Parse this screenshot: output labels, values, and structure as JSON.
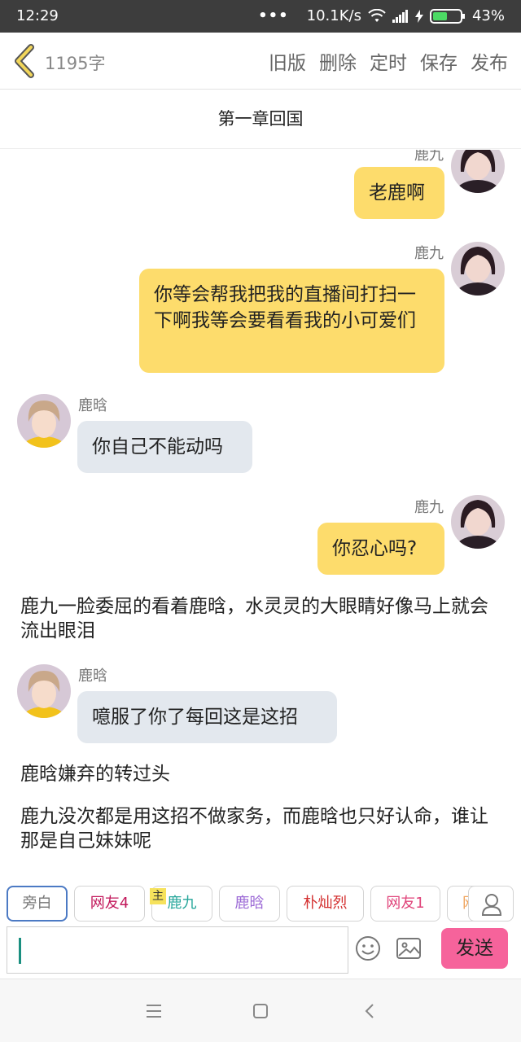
{
  "status_bar": {
    "time": "12:29",
    "dots": "•••",
    "network_speed": "10.1K/s",
    "battery": "43%"
  },
  "toolbar": {
    "back_icon": "chevron-left-icon",
    "word_count": "1195字",
    "actions": [
      "旧版",
      "删除",
      "定时",
      "保存",
      "发布"
    ]
  },
  "chapter_title": "第一章回国",
  "messages": [
    {
      "speaker": "鹿九",
      "side": "right",
      "text": "老鹿啊"
    },
    {
      "speaker": "鹿九",
      "side": "right",
      "text": "你等会帮我把我的直播间打扫一下啊我等会要看看我的小可爱们"
    },
    {
      "speaker": "鹿晗",
      "side": "left",
      "text": "你自己不能动吗"
    },
    {
      "speaker": "鹿九",
      "side": "right",
      "text": "你忍心吗?"
    },
    {
      "type": "narration",
      "text": "鹿九一脸委屈的看着鹿晗，水灵灵的大眼睛好像马上就会流出眼泪"
    },
    {
      "speaker": "鹿晗",
      "side": "left",
      "text": "噫服了你了每回这是这招"
    },
    {
      "type": "narration",
      "text": "鹿晗嫌弃的转过头"
    },
    {
      "type": "narration",
      "text": "鹿九没次都是用这招不做家务，而鹿晗也只好认命，谁让那是自己妹妹呢"
    }
  ],
  "roles": [
    {
      "label": "旁白",
      "color": "#888888",
      "active": true
    },
    {
      "label": "网友4",
      "color": "#c2185b"
    },
    {
      "label": "鹿九",
      "color": "#26a69a",
      "badge": "主"
    },
    {
      "label": "鹿晗",
      "color": "#9c6ad6"
    },
    {
      "label": "朴灿烈",
      "color": "#d32f2f"
    },
    {
      "label": "网友1",
      "color": "#e0457b"
    },
    {
      "label": "网",
      "color": "#f0a35a"
    }
  ],
  "input": {
    "placeholder": "",
    "send_label": "发送"
  },
  "colors": {
    "bubble_right": "#fddc6c",
    "bubble_left": "#e3e8ee",
    "send_button": "#f6639b",
    "status_bar": "#3d3d3d"
  }
}
